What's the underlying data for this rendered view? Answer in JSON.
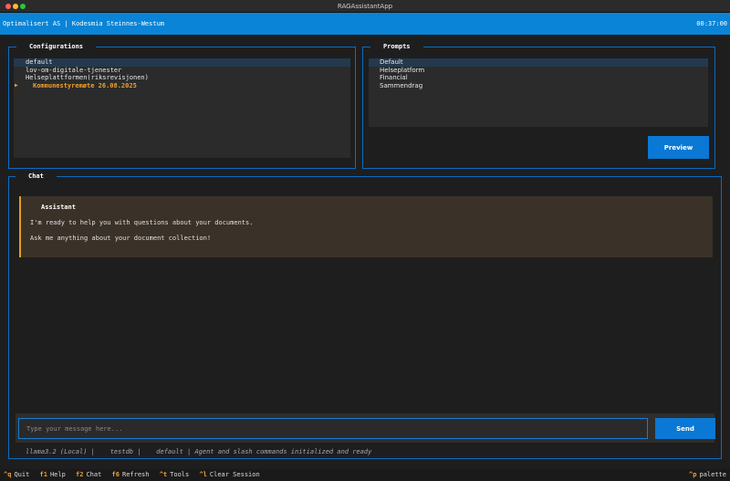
{
  "window": {
    "title": "RAGAssistantApp"
  },
  "header": {
    "title": "Optimalisert AS | Kodesmia Steinnes-Westum",
    "clock": "00:37:00"
  },
  "configurations": {
    "title": "Configurations",
    "items": [
      {
        "label": "default",
        "selected": true
      },
      {
        "label": "lov-om-digitale-tjenester"
      },
      {
        "label": "Helseplattformen(riksrevisjonen)"
      },
      {
        "label": "Kommunestyremøte 26.08.2025",
        "active": true,
        "marker": "▶"
      }
    ]
  },
  "prompts": {
    "title": "Prompts",
    "items": [
      {
        "label": "Default",
        "selected": true
      },
      {
        "label": "Helseplatform"
      },
      {
        "label": "Financial"
      },
      {
        "label": "Sammendrag"
      }
    ],
    "preview_label": "Preview"
  },
  "chat": {
    "title": "Chat",
    "messages": [
      {
        "author": "Assistant",
        "lines": [
          "I'm ready to help you with questions about your documents.",
          "Ask me anything about your document collection!"
        ]
      }
    ],
    "input_placeholder": "Type your message here...",
    "send_label": "Send",
    "status": "llama3.2 (Local) |    testdb |    default | Agent and slash commands initialized and ready"
  },
  "footer": {
    "bindings": [
      {
        "key": "^q",
        "label": "Quit"
      },
      {
        "key": "f1",
        "label": "Help"
      },
      {
        "key": "f2",
        "label": "Chat"
      },
      {
        "key": "f6",
        "label": "Refresh"
      },
      {
        "key": "^t",
        "label": "Tools"
      },
      {
        "key": "^l",
        "label": "Clear Session"
      }
    ],
    "palette": {
      "key": "^p",
      "label": "palette"
    }
  },
  "colors": {
    "accent": "#0a84d6",
    "highlight": "#f0a030",
    "border": "#0a6cc2"
  }
}
